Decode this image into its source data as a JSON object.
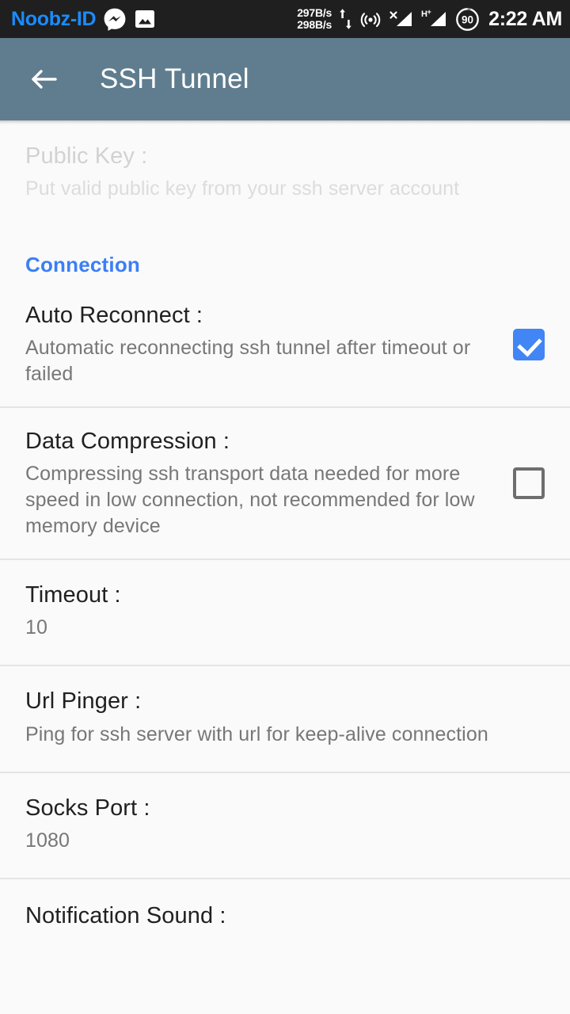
{
  "status_bar": {
    "carrier": "Noobz-ID",
    "icons": [
      "messenger-icon",
      "gallery-icon"
    ],
    "net_speed_up": "297B/s",
    "net_speed_down": "298B/s",
    "signal_icons": [
      "up-down-arrows-icon",
      "hotspot-icon",
      "sim1-signal-icon",
      "sim2-signal-hplus-icon"
    ],
    "network_type": "H+",
    "battery_level": "90",
    "clock": "2:22 AM",
    "background_color": "#1f1f1f",
    "carrier_color": "#1a8cff"
  },
  "app_bar": {
    "title": "SSH Tunnel",
    "back_icon": "arrow-left-icon",
    "background_color": "#5f7d8f"
  },
  "sections": {
    "connection_header": "Connection",
    "connection_header_color": "#3b7ff5"
  },
  "preferences": {
    "public_key": {
      "title": "Public Key :",
      "summary": "Put valid public key from your ssh server account",
      "enabled": false
    },
    "auto_reconnect": {
      "title": "Auto Reconnect :",
      "summary": "Automatic reconnecting ssh tunnel after timeout or failed",
      "checked": true
    },
    "data_compression": {
      "title": "Data Compression :",
      "summary": "Compressing ssh transport data needed for more speed in low connection, not recommended for low memory device",
      "checked": false
    },
    "timeout": {
      "title": "Timeout :",
      "value": "10"
    },
    "url_pinger": {
      "title": "Url Pinger :",
      "summary": "Ping for ssh server with url for keep-alive connection"
    },
    "socks_port": {
      "title": "Socks Port :",
      "value": "1080"
    },
    "notification_sound": {
      "title": "Notification Sound :"
    }
  }
}
